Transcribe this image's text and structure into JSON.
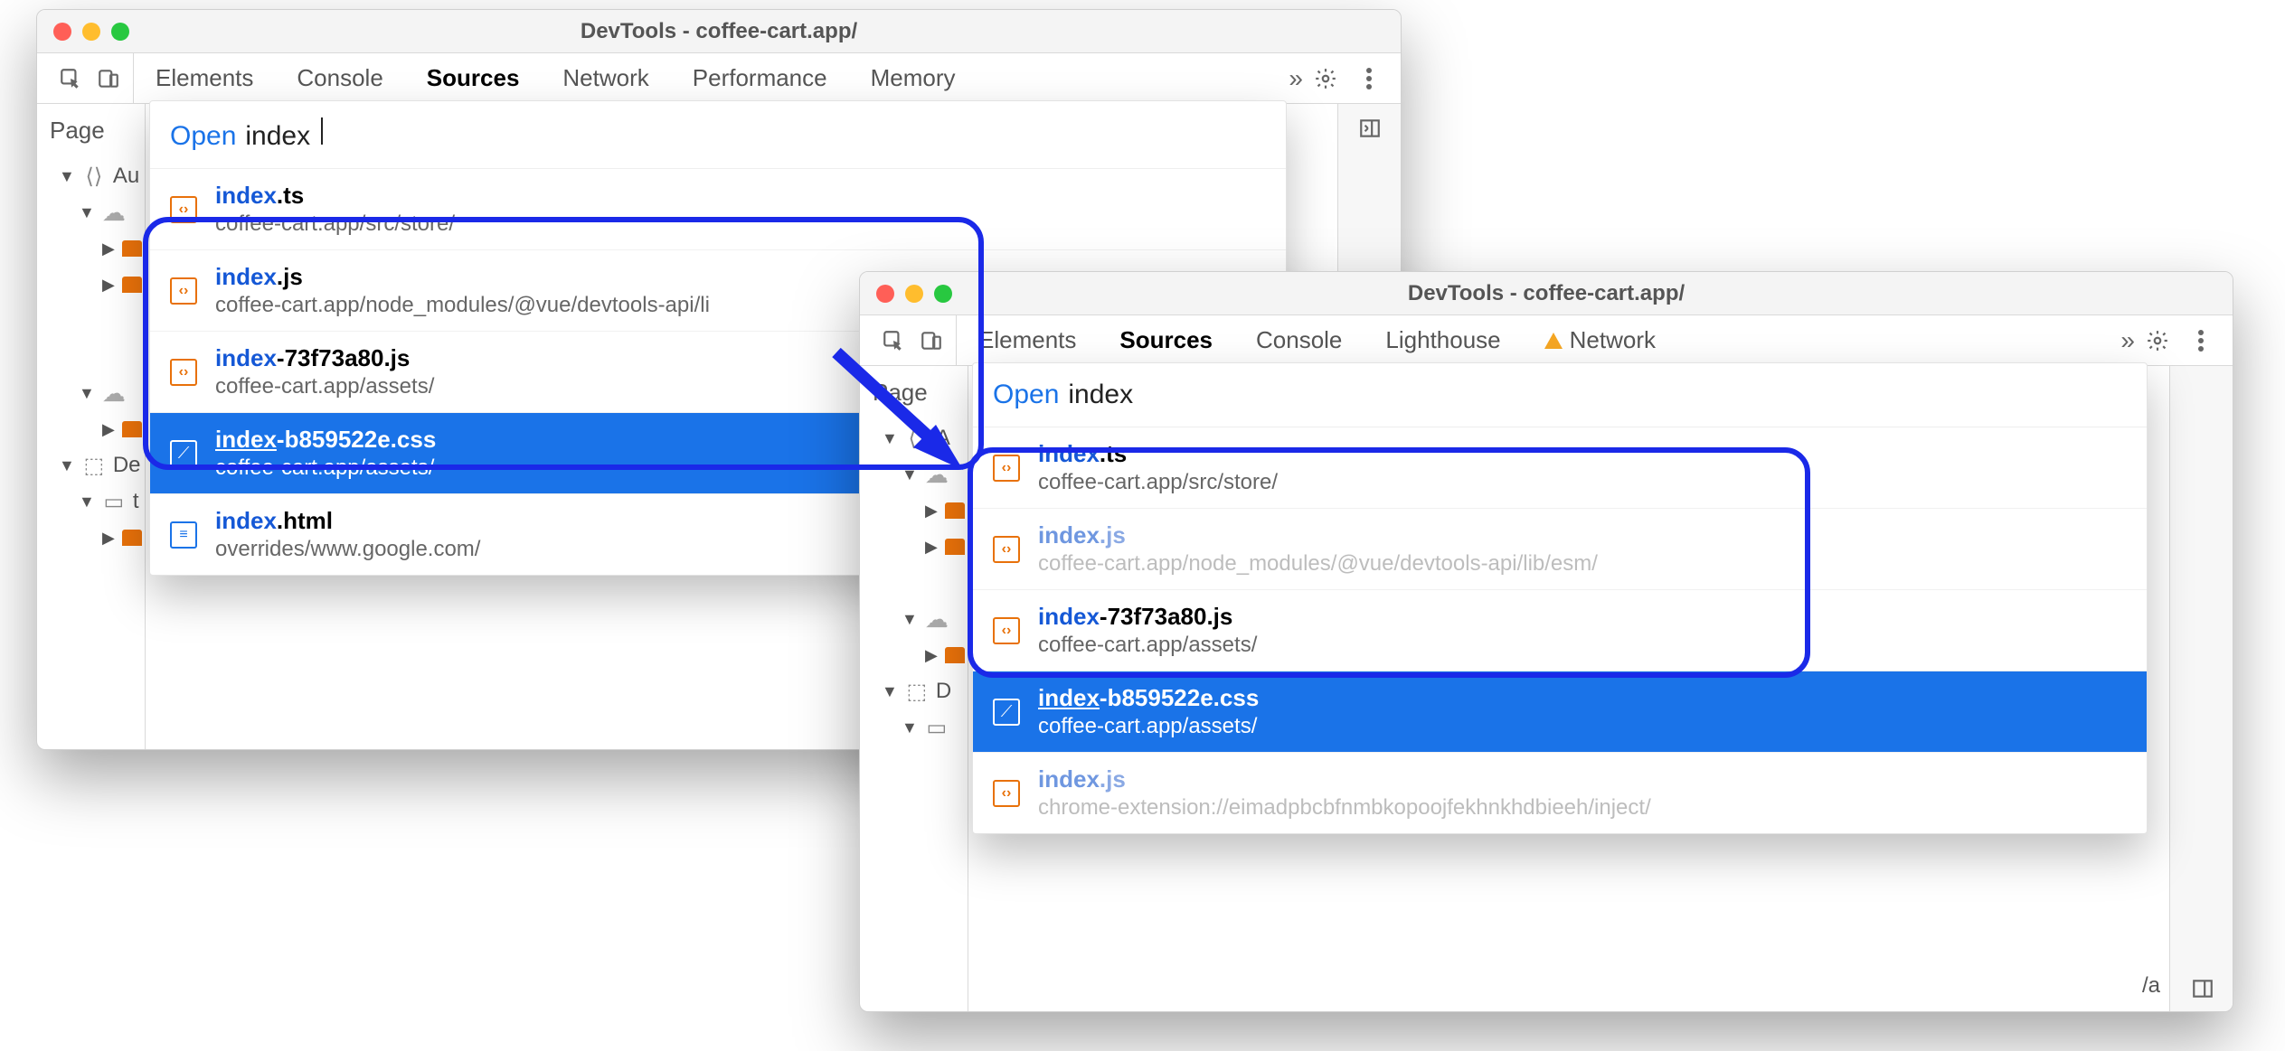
{
  "window_title": "DevTools - coffee-cart.app/",
  "page_label": "Page",
  "cmd_keyword": "Open",
  "tabs1": [
    "Elements",
    "Console",
    "Sources",
    "Network",
    "Performance",
    "Memory"
  ],
  "tabs1_active": "Sources",
  "tabs2": [
    "Elements",
    "Sources",
    "Console",
    "Lighthouse",
    "Network"
  ],
  "tabs2_active": "Sources",
  "tabs2_warn": "Network",
  "query1": "index",
  "query2": "index",
  "results1": [
    {
      "name_match": "index",
      "name_rest": ".ts",
      "sub": "coffee-cart.app/src/store/",
      "ico": "js",
      "dim": false,
      "sel": false
    },
    {
      "name_match": "index",
      "name_rest": ".js",
      "sub": "coffee-cart.app/node_modules/@vue/devtools-api/li",
      "ico": "js",
      "dim": false,
      "sel": false
    },
    {
      "name_match": "index",
      "name_rest": "-73f73a80.js",
      "sub": "coffee-cart.app/assets/",
      "ico": "js",
      "dim": false,
      "sel": false
    },
    {
      "name_match": "index",
      "name_rest": "-b859522e.css",
      "sub": "coffee-cart.app/assets/",
      "ico": "css",
      "dim": false,
      "sel": true
    },
    {
      "name_match": "index",
      "name_rest": ".html",
      "sub": "overrides/www.google.com/",
      "ico": "html",
      "dim": false,
      "sel": false
    }
  ],
  "results2": [
    {
      "name_match": "index",
      "name_rest": ".ts",
      "sub": "coffee-cart.app/src/store/",
      "ico": "js",
      "dim": false,
      "sel": false
    },
    {
      "name_match": "index",
      "name_rest": ".js",
      "sub": "coffee-cart.app/node_modules/@vue/devtools-api/lib/esm/",
      "ico": "js",
      "dim": true,
      "sel": false
    },
    {
      "name_match": "index",
      "name_rest": "-73f73a80.js",
      "sub": "coffee-cart.app/assets/",
      "ico": "js",
      "dim": false,
      "sel": false
    },
    {
      "name_match": "index",
      "name_rest": "-b859522e.css",
      "sub": "coffee-cart.app/assets/",
      "ico": "css",
      "dim": false,
      "sel": true
    },
    {
      "name_match": "index",
      "name_rest": ".js",
      "sub": "chrome-extension://eimadpbcbfnmbkopoojfekhnkhdbieeh/inject/",
      "ico": "js",
      "dim": true,
      "sel": false
    }
  ],
  "tree1_labels": {
    "au": "Au",
    "de": "De",
    "t": "t"
  },
  "tree2_labels": {
    "au": "A",
    "d": "D",
    "a": "/a"
  }
}
